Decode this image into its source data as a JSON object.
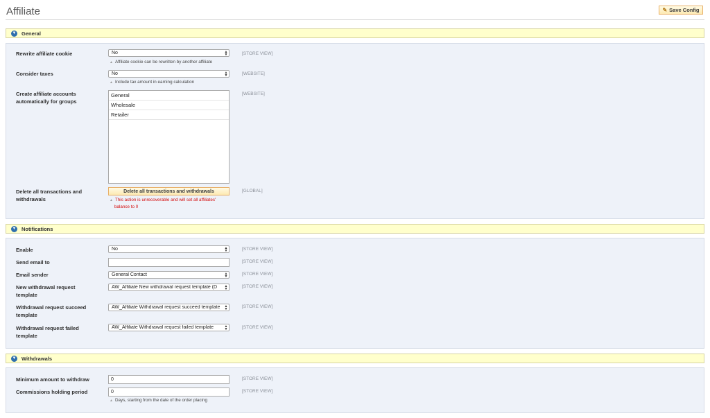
{
  "page": {
    "title": "Affiliate",
    "save_label": "Save Config"
  },
  "general": {
    "heading": "General",
    "rewrite_cookie": {
      "label": "Rewrite affiliate cookie",
      "value": "No",
      "note": "Affiliate cookie can be rewritten by another affiliate",
      "scope": "[STORE VIEW]"
    },
    "consider_taxes": {
      "label": "Consider taxes",
      "value": "No",
      "note": "Include tax amount in earning calculation",
      "scope": "[WEBSITE]"
    },
    "create_accounts": {
      "label_line1": "Create affiliate accounts",
      "label_line2": "automatically for groups",
      "options": [
        "General",
        "Wholesale",
        "Retailer"
      ],
      "scope": "[WEBSITE]"
    },
    "delete_all": {
      "label_line1": "Delete all transactions and",
      "label_line2": "withdrawals",
      "button_label": "Delete all transactions and withdrawals",
      "note_line1": "This action is unrecoverable and will set all affiliates'",
      "note_line2": "balance to 0",
      "scope": "[GLOBAL]"
    }
  },
  "notifications": {
    "heading": "Notifications",
    "enable": {
      "label": "Enable",
      "value": "No",
      "scope": "[STORE VIEW]"
    },
    "send_email_to": {
      "label": "Send email to",
      "value": "",
      "scope": "[STORE VIEW]"
    },
    "email_sender": {
      "label": "Email sender",
      "value": "General Contact",
      "scope": "[STORE VIEW]"
    },
    "new_withdrawal_template": {
      "label_line1": "New withdrawal request",
      "label_line2": "template",
      "value": "AW_Affiliate New withdrawal request template (D",
      "scope": "[STORE VIEW]"
    },
    "succeed_template": {
      "label_line1": "Withdrawal request succeed",
      "label_line2": "template",
      "value": "AW_Affiliate Withdrawal request succeed template",
      "scope": "[STORE VIEW]"
    },
    "failed_template": {
      "label_line1": "Withdrawal request failed",
      "label_line2": "template",
      "value": "AW_Affiliate Withdrawal request failed template",
      "scope": "[STORE VIEW]"
    }
  },
  "withdrawals": {
    "heading": "Withdrawals",
    "min_amount": {
      "label": "Minimum amount to withdraw",
      "value": "0",
      "scope": "[STORE VIEW]"
    },
    "holding_period": {
      "label": "Commissions holding period",
      "value": "0",
      "note": "Days, starting from the date of the order placing",
      "scope": "[STORE VIEW]"
    }
  },
  "icons": {
    "section_toggle": "chevron-down-circle-icon",
    "save": "save-icon",
    "note": "triangle-up-icon",
    "select_arrows": "updown-arrows-icon"
  },
  "colors": {
    "section_header_bg": "#ffffcc",
    "section_body_bg": "#eef2f9",
    "warning_text": "#d40707",
    "button_border": "#e8b06a",
    "toggle_icon": "#2f6fad"
  }
}
